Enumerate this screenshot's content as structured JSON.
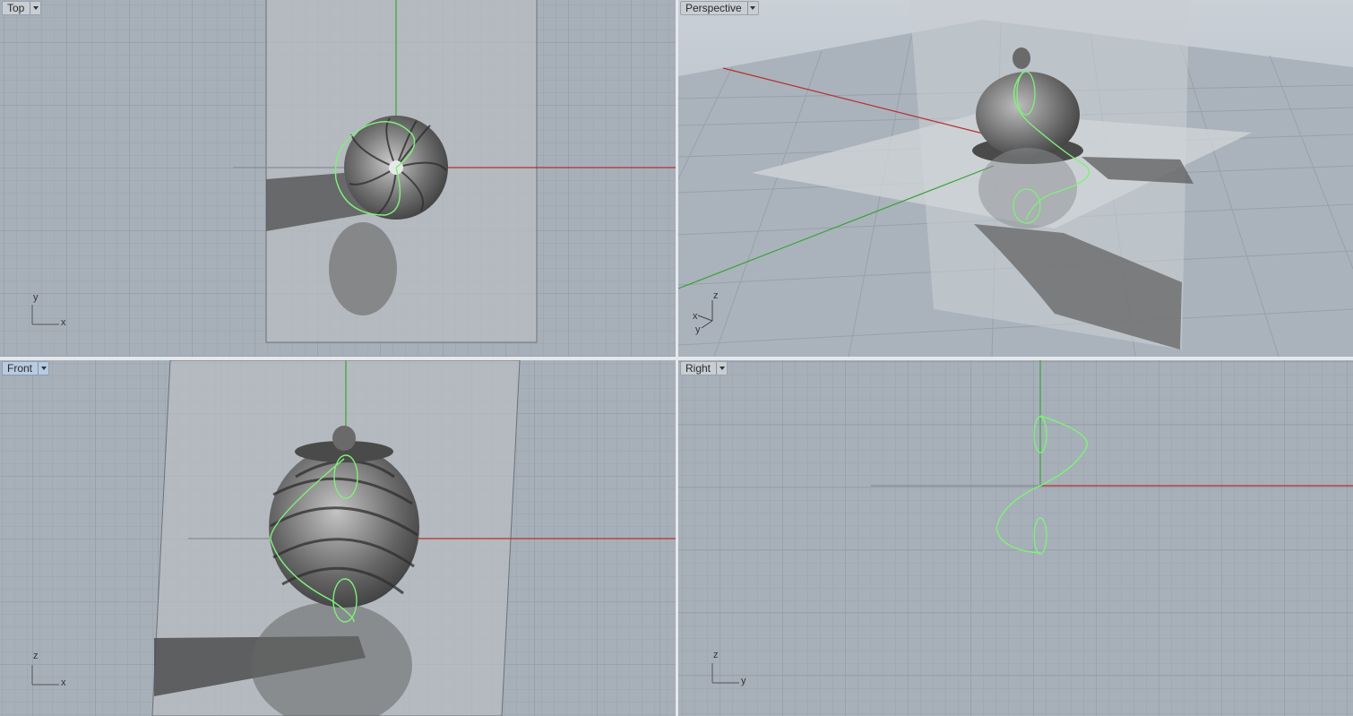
{
  "viewports": {
    "top": {
      "label": "Top",
      "axis_h": "x",
      "axis_v": "y"
    },
    "perspective": {
      "label": "Perspective",
      "axis_1": "z",
      "axis_2": "x",
      "axis_3": "y"
    },
    "front": {
      "label": "Front",
      "axis_h": "x",
      "axis_v": "z"
    },
    "right": {
      "label": "Right",
      "axis_h": "y",
      "axis_v": "z"
    }
  },
  "colors": {
    "background": "#a7b0b9",
    "grid_minor": "#9ba4ad",
    "grid_major": "#8c959e",
    "x_axis": "#b5302f",
    "y_axis": "#3aa33a",
    "curve": "#7ff07a",
    "active_tab": "#b9cbe0"
  },
  "icons": {
    "dropdown": "chevron-down-icon"
  }
}
